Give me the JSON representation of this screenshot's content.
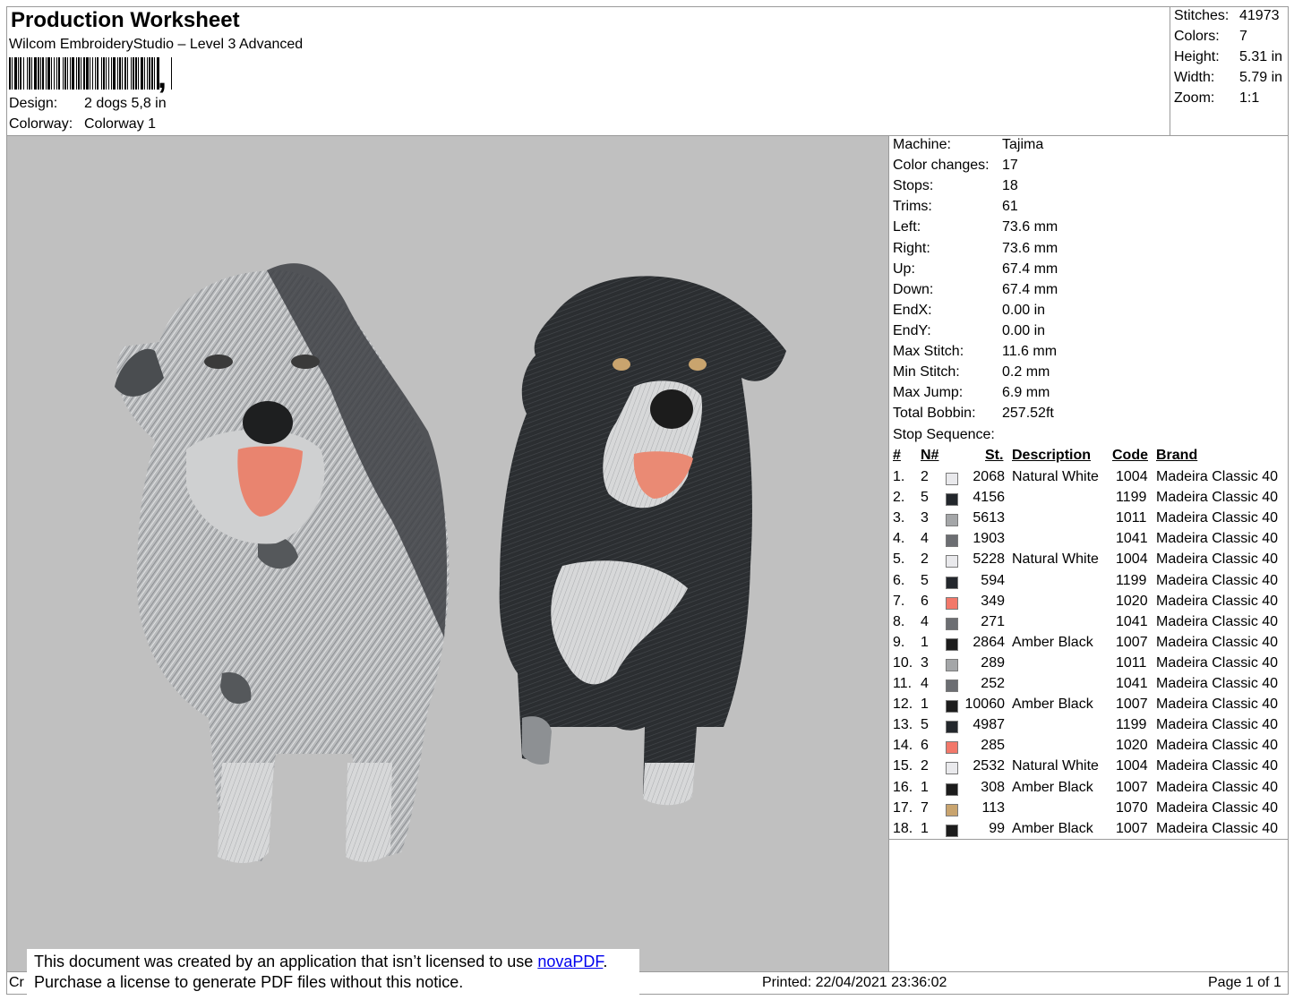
{
  "header": {
    "title": "Production Worksheet",
    "software": "Wilcom EmbroideryStudio – Level 3 Advanced",
    "barcode_suffix": ",",
    "design_label": "Design:",
    "design_value": "2 dogs 5,8 in",
    "colorway_label": "Colorway:",
    "colorway_value": "Colorway 1"
  },
  "stats": [
    {
      "label": "Stitches:",
      "value": "41973"
    },
    {
      "label": "Colors:",
      "value": "7"
    },
    {
      "label": "Height:",
      "value": "5.31 in"
    },
    {
      "label": "Width:",
      "value": "5.79 in"
    },
    {
      "label": "Zoom:",
      "value": "1:1"
    }
  ],
  "machine_info": [
    {
      "label": "Machine:",
      "value": "Tajima"
    },
    {
      "label": "Color changes:",
      "value": "17"
    },
    {
      "label": "Stops:",
      "value": "18"
    },
    {
      "label": "Trims:",
      "value": "61"
    },
    {
      "label": "Left:",
      "value": "73.6 mm"
    },
    {
      "label": "Right:",
      "value": "73.6 mm"
    },
    {
      "label": "Up:",
      "value": "67.4 mm"
    },
    {
      "label": "Down:",
      "value": "67.4 mm"
    },
    {
      "label": "EndX:",
      "value": "0.00 in"
    },
    {
      "label": "EndY:",
      "value": "0.00 in"
    },
    {
      "label": "Max Stitch:",
      "value": "11.6 mm"
    },
    {
      "label": "Min Stitch:",
      "value": "0.2 mm"
    },
    {
      "label": "Max Jump:",
      "value": "6.9 mm"
    },
    {
      "label": "Total Bobbin:",
      "value": "257.52ft"
    }
  ],
  "stop_sequence": {
    "title": "Stop Sequence:",
    "headers": {
      "index": "#",
      "needle": "N#",
      "stitches": "St.",
      "description": "Description",
      "code": "Code",
      "brand": "Brand"
    },
    "rows": [
      {
        "index": "1.",
        "needle": "2",
        "color": "#e9e9ec",
        "stitches": "2068",
        "description": "Natural White",
        "code": "1004",
        "brand": "Madeira Classic 40"
      },
      {
        "index": "2.",
        "needle": "5",
        "color": "#23272c",
        "stitches": "4156",
        "description": "",
        "code": "1199",
        "brand": "Madeira Classic 40"
      },
      {
        "index": "3.",
        "needle": "3",
        "color": "#a4a6a8",
        "stitches": "5613",
        "description": "",
        "code": "1011",
        "brand": "Madeira Classic 40"
      },
      {
        "index": "4.",
        "needle": "4",
        "color": "#6c6e72",
        "stitches": "1903",
        "description": "",
        "code": "1041",
        "brand": "Madeira Classic 40"
      },
      {
        "index": "5.",
        "needle": "2",
        "color": "#e9e9ec",
        "stitches": "5228",
        "description": "Natural White",
        "code": "1004",
        "brand": "Madeira Classic 40"
      },
      {
        "index": "6.",
        "needle": "5",
        "color": "#23272c",
        "stitches": "594",
        "description": "",
        "code": "1199",
        "brand": "Madeira Classic 40"
      },
      {
        "index": "7.",
        "needle": "6",
        "color": "#f2786a",
        "stitches": "349",
        "description": "",
        "code": "1020",
        "brand": "Madeira Classic 40"
      },
      {
        "index": "8.",
        "needle": "4",
        "color": "#6c6e72",
        "stitches": "271",
        "description": "",
        "code": "1041",
        "brand": "Madeira Classic 40"
      },
      {
        "index": "9.",
        "needle": "1",
        "color": "#1c1c1c",
        "stitches": "2864",
        "description": "Amber Black",
        "code": "1007",
        "brand": "Madeira Classic 40"
      },
      {
        "index": "10.",
        "needle": "3",
        "color": "#a4a6a8",
        "stitches": "289",
        "description": "",
        "code": "1011",
        "brand": "Madeira Classic 40"
      },
      {
        "index": "11.",
        "needle": "4",
        "color": "#6c6e72",
        "stitches": "252",
        "description": "",
        "code": "1041",
        "brand": "Madeira Classic 40"
      },
      {
        "index": "12.",
        "needle": "1",
        "color": "#1c1c1c",
        "stitches": "10060",
        "description": "Amber Black",
        "code": "1007",
        "brand": "Madeira Classic 40"
      },
      {
        "index": "13.",
        "needle": "5",
        "color": "#23272c",
        "stitches": "4987",
        "description": "",
        "code": "1199",
        "brand": "Madeira Classic 40"
      },
      {
        "index": "14.",
        "needle": "6",
        "color": "#f2786a",
        "stitches": "285",
        "description": "",
        "code": "1020",
        "brand": "Madeira Classic 40"
      },
      {
        "index": "15.",
        "needle": "2",
        "color": "#e9e9ec",
        "stitches": "2532",
        "description": "Natural White",
        "code": "1004",
        "brand": "Madeira Classic 40"
      },
      {
        "index": "16.",
        "needle": "1",
        "color": "#1c1c1c",
        "stitches": "308",
        "description": "Amber Black",
        "code": "1007",
        "brand": "Madeira Classic 40"
      },
      {
        "index": "17.",
        "needle": "7",
        "color": "#c9a46e",
        "stitches": "113",
        "description": "",
        "code": "1070",
        "brand": "Madeira Classic 40"
      },
      {
        "index": "18.",
        "needle": "1",
        "color": "#1c1c1c",
        "stitches": "99",
        "description": "Amber Black",
        "code": "1007",
        "brand": "Madeira Classic 40"
      }
    ]
  },
  "preview": {
    "background": "#c0c0c0"
  },
  "footer": {
    "left_text": "Cr",
    "printed": "Printed: 22/04/2021 23:36:02",
    "page": "Page 1 of 1"
  },
  "notice": {
    "line1_prefix": "This document was created by an application that isn’t licensed to use ",
    "link_text": "novaPDF",
    "line1_suffix": ".",
    "line2": "Purchase a license to generate PDF files without this notice."
  }
}
